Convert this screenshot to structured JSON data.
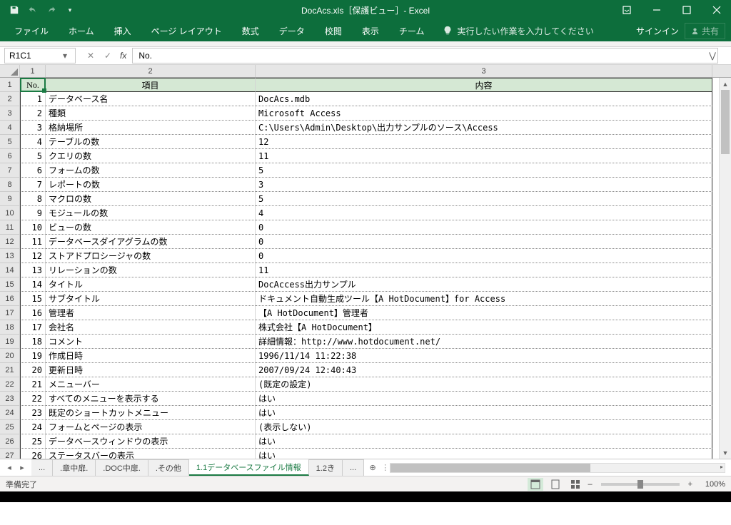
{
  "title": "DocAcs.xls［保護ビュー］- Excel",
  "ribbon": {
    "file": "ファイル",
    "home": "ホーム",
    "insert": "挿入",
    "page": "ページ レイアウト",
    "formulas": "数式",
    "data": "データ",
    "review": "校閲",
    "view": "表示",
    "team": "チーム",
    "tellme": "実行したい作業を入力してください",
    "signin": "サインイン",
    "share": "共有"
  },
  "namebox": "R1C1",
  "formula": "No.",
  "colHeaders": [
    "1",
    "2",
    "3"
  ],
  "headerRow": {
    "no": "No.",
    "item": "項目",
    "content": "内容"
  },
  "rows": [
    {
      "n": "1",
      "item": "データベース名",
      "val": "DocAcs.mdb"
    },
    {
      "n": "2",
      "item": "種類",
      "val": "Microsoft Access"
    },
    {
      "n": "3",
      "item": "格納場所",
      "val": "C:\\Users\\Admin\\Desktop\\出力サンプルのソース\\Access"
    },
    {
      "n": "4",
      "item": "テーブルの数",
      "val": "12"
    },
    {
      "n": "5",
      "item": "クエリの数",
      "val": "11"
    },
    {
      "n": "6",
      "item": "フォームの数",
      "val": "5"
    },
    {
      "n": "7",
      "item": "レポートの数",
      "val": "3"
    },
    {
      "n": "8",
      "item": "マクロの数",
      "val": "5"
    },
    {
      "n": "9",
      "item": "モジュールの数",
      "val": "4"
    },
    {
      "n": "10",
      "item": "ビューの数",
      "val": "0"
    },
    {
      "n": "11",
      "item": "データベースダイアグラムの数",
      "val": "0"
    },
    {
      "n": "12",
      "item": "ストアドプロシージャの数",
      "val": "0"
    },
    {
      "n": "13",
      "item": "リレーションの数",
      "val": "11"
    },
    {
      "n": "14",
      "item": "タイトル",
      "val": "DocAccess出力サンプル"
    },
    {
      "n": "15",
      "item": "サブタイトル",
      "val": "ドキュメント自動生成ツール【A HotDocument】for Access"
    },
    {
      "n": "16",
      "item": "管理者",
      "val": "【A HotDocument】管理者"
    },
    {
      "n": "17",
      "item": "会社名",
      "val": "株式会社【A HotDocument】"
    },
    {
      "n": "18",
      "item": "コメント",
      "val": "詳細情報：http://www.hotdocument.net/"
    },
    {
      "n": "19",
      "item": "作成日時",
      "val": "1996/11/14 11:22:38"
    },
    {
      "n": "20",
      "item": "更新日時",
      "val": "2007/09/24 12:40:43"
    },
    {
      "n": "21",
      "item": "メニューバー",
      "val": "(既定の設定)"
    },
    {
      "n": "22",
      "item": "すべてのメニューを表示する",
      "val": "はい"
    },
    {
      "n": "23",
      "item": "既定のショートカットメニュー",
      "val": "はい"
    },
    {
      "n": "24",
      "item": "フォームとページの表示",
      "val": "(表示しない)"
    },
    {
      "n": "25",
      "item": "データベースウィンドウの表示",
      "val": "はい"
    },
    {
      "n": "26",
      "item": "ステータスバーの表示",
      "val": "はい"
    }
  ],
  "sheets": {
    "ellipsis": "...",
    "s1": ".章中扉.",
    "s2": ".DOC中扉.",
    "s3": ".その他",
    "active": "1.1データベースファイル情報",
    "s5": "1.2き",
    "more": "..."
  },
  "status": {
    "ready": "準備完了",
    "zoom": "100%"
  }
}
